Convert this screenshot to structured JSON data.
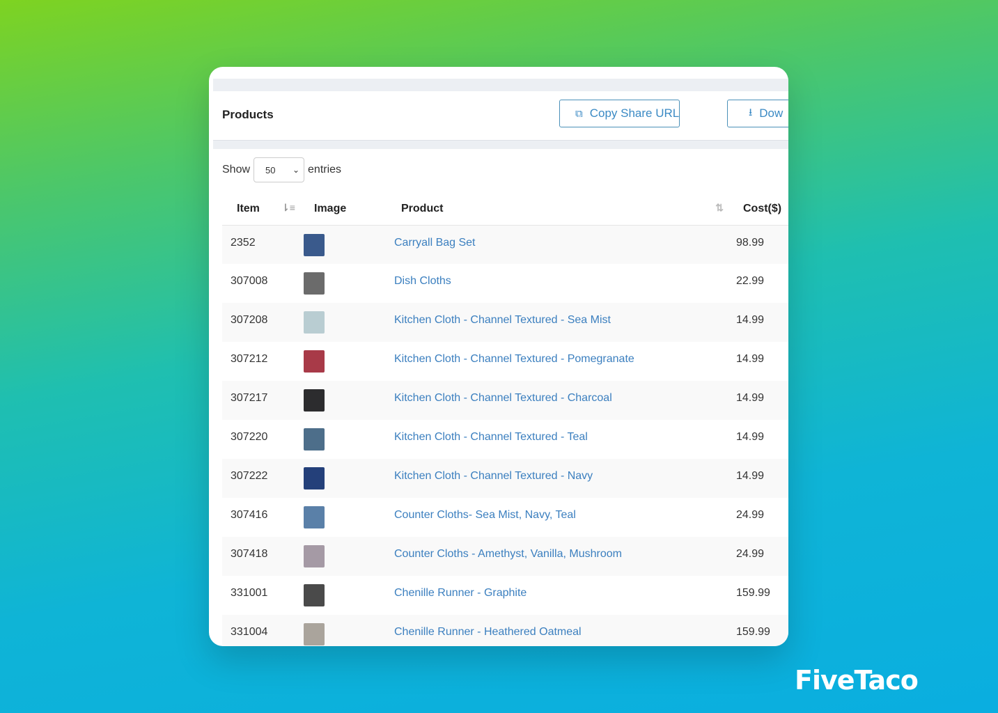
{
  "panel": {
    "title": "Products",
    "copy_label": "Copy Share URL",
    "download_label": "Dow"
  },
  "length": {
    "show": "Show",
    "value": "50",
    "entries": "entries"
  },
  "columns": [
    "Item",
    "Image",
    "Product",
    "Cost($)"
  ],
  "rows": [
    {
      "item": "2352",
      "product": "Carryall Bag Set",
      "cost": "98.99",
      "color": "#3a5a8c"
    },
    {
      "item": "307008",
      "product": "Dish Cloths",
      "cost": "22.99",
      "color": "#6b6b6b"
    },
    {
      "item": "307208",
      "product": "Kitchen Cloth - Channel Textured - Sea Mist",
      "cost": "14.99",
      "color": "#b9cdd2"
    },
    {
      "item": "307212",
      "product": "Kitchen Cloth - Channel Textured - Pomegranate",
      "cost": "14.99",
      "color": "#a83a48"
    },
    {
      "item": "307217",
      "product": "Kitchen Cloth - Channel Textured - Charcoal",
      "cost": "14.99",
      "color": "#2c2c2e"
    },
    {
      "item": "307220",
      "product": "Kitchen Cloth - Channel Textured - Teal",
      "cost": "14.99",
      "color": "#4d6e8a"
    },
    {
      "item": "307222",
      "product": "Kitchen Cloth - Channel Textured - Navy",
      "cost": "14.99",
      "color": "#24407a"
    },
    {
      "item": "307416",
      "product": "Counter Cloths- Sea Mist, Navy, Teal",
      "cost": "24.99",
      "color": "#5a80a8"
    },
    {
      "item": "307418",
      "product": "Counter Cloths - Amethyst, Vanilla, Mushroom",
      "cost": "24.99",
      "color": "#a59aa5"
    },
    {
      "item": "331001",
      "product": "Chenille Runner - Graphite",
      "cost": "159.99",
      "color": "#4a4a4a"
    },
    {
      "item": "331004",
      "product": "Chenille Runner - Heathered Oatmeal",
      "cost": "159.99",
      "color": "#aaa49c"
    }
  ],
  "brand": "FiveTaco"
}
